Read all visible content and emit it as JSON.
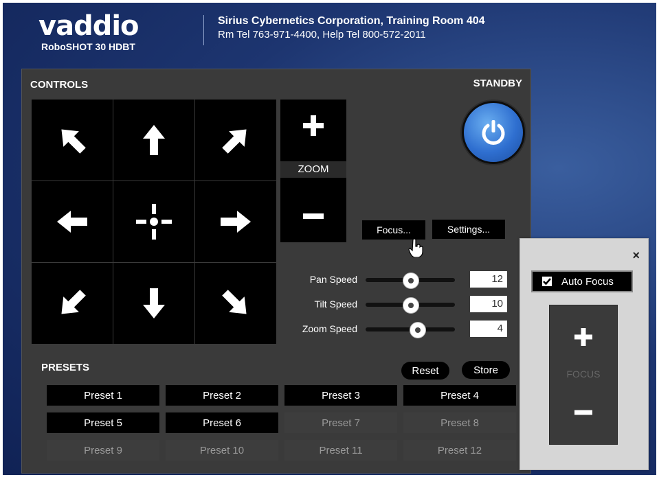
{
  "header": {
    "logo": "vaddio",
    "model": "RoboSHOT 30 HDBT",
    "location": "Sirius Cybernetics Corporation, Training Room 404",
    "phones": "Rm Tel 763-971-4400, Help Tel 800-572-2011"
  },
  "controls": {
    "title": "CONTROLS",
    "standby_title": "STANDBY",
    "zoom_label": "ZOOM",
    "focus_button": "Focus...",
    "settings_button": "Settings...",
    "sliders": [
      {
        "label": "Pan Speed",
        "value": "12",
        "fraction": 0.5
      },
      {
        "label": "Tilt Speed",
        "value": "10",
        "fraction": 0.5
      },
      {
        "label": "Zoom Speed",
        "value": "4",
        "fraction": 0.58
      }
    ]
  },
  "presets": {
    "title": "PRESETS",
    "reset": "Reset",
    "store": "Store",
    "items": [
      {
        "label": "Preset 1",
        "active": true
      },
      {
        "label": "Preset 2",
        "active": true
      },
      {
        "label": "Preset 3",
        "active": true
      },
      {
        "label": "Preset 4",
        "active": true
      },
      {
        "label": "Preset 5",
        "active": true
      },
      {
        "label": "Preset 6",
        "active": true
      },
      {
        "label": "Preset 7",
        "active": false
      },
      {
        "label": "Preset 8",
        "active": false
      },
      {
        "label": "Preset 9",
        "active": false
      },
      {
        "label": "Preset 10",
        "active": false
      },
      {
        "label": "Preset 11",
        "active": false
      },
      {
        "label": "Preset 12",
        "active": false
      }
    ]
  },
  "focus_popup": {
    "close": "×",
    "auto_focus_label": "Auto Focus",
    "auto_focus_checked": true,
    "focus_label": "FOCUS"
  },
  "colors": {
    "background": "#1d3570",
    "panel": "#3a3a3a",
    "standby": "#2f6fd0"
  }
}
